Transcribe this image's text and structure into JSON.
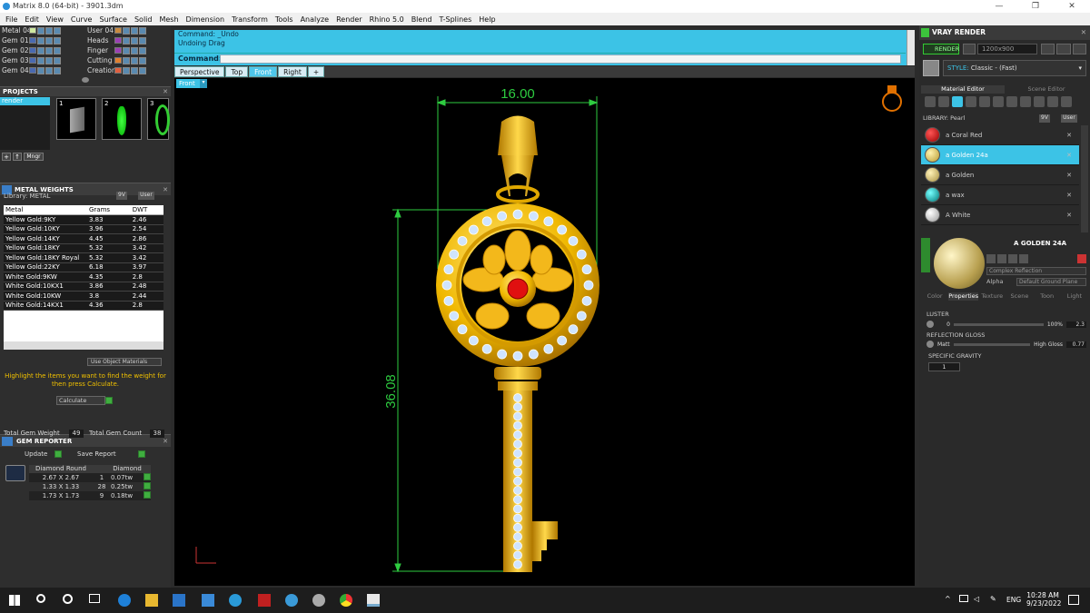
{
  "titlebar": {
    "title": "Matrix 8.0 (64-bit) - 3901.3dm",
    "minimize": "—",
    "maximize": "❐",
    "close": "✕"
  },
  "menu": [
    "File",
    "Edit",
    "View",
    "Curve",
    "Surface",
    "Solid",
    "Mesh",
    "Dimension",
    "Transform",
    "Tools",
    "Analyze",
    "Render",
    "Rhino 5.0",
    "Blend",
    "T-Splines",
    "Help"
  ],
  "layers": {
    "left": [
      {
        "name": "Metal 04",
        "color": "#cfe8a0"
      },
      {
        "name": "Gem 01",
        "color": "#4a6ab0"
      },
      {
        "name": "Gem 02",
        "color": "#4a6ab0"
      },
      {
        "name": "Gem 03",
        "color": "#4a6ab0"
      },
      {
        "name": "Gem 04",
        "color": "#4a6ab0"
      }
    ],
    "right": [
      {
        "name": "User 04",
        "color": "#c88a40"
      },
      {
        "name": "Heads",
        "color": "#9b3fb4"
      },
      {
        "name": "Finger",
        "color": "#9b3fb4"
      },
      {
        "name": "Cutting",
        "color": "#e08030"
      },
      {
        "name": "Creation",
        "color": "#e06040"
      }
    ]
  },
  "projects": {
    "title": "PROJECTS",
    "item": "render",
    "thumbs": [
      "1",
      "2",
      "3"
    ],
    "mngr": "Mngr"
  },
  "metal_weights": {
    "title": "METAL WEIGHTS",
    "library_label": "Library: METAL",
    "lib_9v": "9V",
    "lib_user": "User",
    "headers": [
      "Metal",
      "Grams",
      "DWT"
    ],
    "rows": [
      [
        "Yellow Gold:9KY",
        "3.83",
        "2.46"
      ],
      [
        "Yellow Gold:10KY",
        "3.96",
        "2.54"
      ],
      [
        "Yellow Gold:14KY",
        "4.45",
        "2.86"
      ],
      [
        "Yellow Gold:18KY",
        "5.32",
        "3.42"
      ],
      [
        "Yellow Gold:18KY Royal",
        "5.32",
        "3.42"
      ],
      [
        "Yellow Gold:22KY",
        "6.18",
        "3.97"
      ],
      [
        "White Gold:9KW",
        "4.35",
        "2.8"
      ],
      [
        "White Gold:10KX1",
        "3.86",
        "2.48"
      ],
      [
        "White Gold:10KW",
        "3.8",
        "2.44"
      ],
      [
        "White Gold:14KX1",
        "4.36",
        "2.8"
      ]
    ],
    "use_object_materials": "Use Object Materials",
    "instruction": "Highlight the items you want to find the weight for then press Calculate.",
    "calculate": "Calculate"
  },
  "gem_reporter": {
    "title": "GEM REPORTER",
    "total_weight_label": "Total Gem Weight",
    "total_weight": "49",
    "total_count_label": "Total Gem Count",
    "total_count": "38",
    "update": "Update",
    "save_report": "Save Report",
    "headers": [
      "Diamond Round",
      "",
      "Diamond"
    ],
    "rows": [
      [
        "2.67 X 2.67",
        "1",
        "0.07tw"
      ],
      [
        "1.33 X 1.33",
        "28",
        "0.25tw"
      ],
      [
        "1.73 X 1.73",
        "9",
        "0.18tw"
      ]
    ]
  },
  "command": {
    "line1": "Command: _Undo",
    "line2": "Undoing Drag",
    "prompt": "Command:"
  },
  "view_tabs": [
    "Perspective",
    "Top",
    "Front",
    "Right",
    "+"
  ],
  "active_tab": "Front",
  "viewport_label": "Front",
  "dimensions": {
    "width": "16.00",
    "height": "36.08"
  },
  "vray": {
    "title": "VRAY RENDER",
    "render_btn": "RENDER",
    "resolution": "1200x900",
    "style_label": "STYLE:",
    "style_value": "Classic - (Fast)",
    "tabs": [
      "Material Editor",
      "Scene Editor"
    ],
    "library_label": "LIBRARY: Pearl",
    "lib_9v": "9V",
    "lib_user": "User",
    "materials": [
      {
        "name": "a Coral Red",
        "color": "#c81818"
      },
      {
        "name": "a Golden 24a",
        "color": "#d9c060"
      },
      {
        "name": "a Golden",
        "color": "#d6c06a"
      },
      {
        "name": "a wax",
        "color": "#1fa8b0"
      },
      {
        "name": "A White",
        "color": "#e8e8e8"
      }
    ],
    "selected_material": "A GOLDEN 24A",
    "reflection": "Complex Reflection",
    "alpha": "Alpha",
    "ground": "Default Ground Plane",
    "prop_tabs": [
      "Color",
      "Properties",
      "Texture",
      "Scene",
      "Toon",
      "Light"
    ],
    "luster_label": "LUSTER",
    "luster_min": "0",
    "luster_max": "100%",
    "luster_value": "2.3",
    "gloss_label": "REFLECTION GLOSS",
    "gloss_min": "Matt",
    "gloss_max": "High Gloss",
    "gloss_value": "0.77",
    "gravity_label": "SPECIFIC GRAVITY",
    "gravity_value": "1"
  },
  "taskbar": {
    "time": "10:28 AM",
    "date": "9/23/2022",
    "lang": "ENG"
  }
}
